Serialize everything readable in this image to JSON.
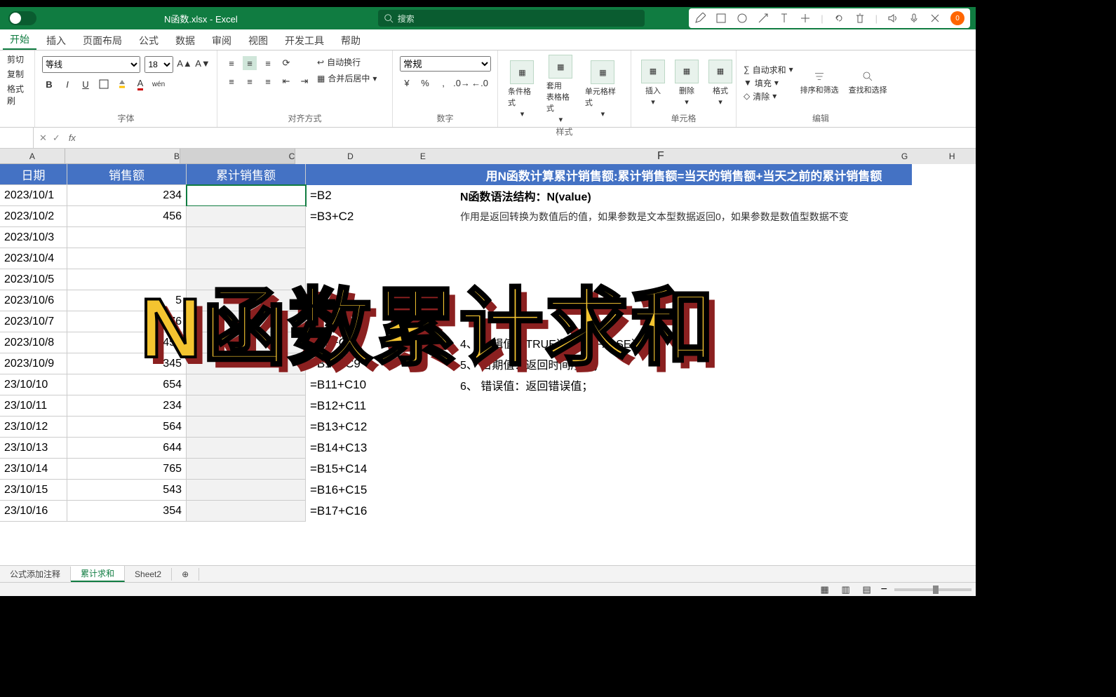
{
  "title": "N函数.xlsx - Excel",
  "search_placeholder": "搜索",
  "tabs": [
    "开始",
    "插入",
    "页面布局",
    "公式",
    "数据",
    "审阅",
    "视图",
    "开发工具",
    "帮助"
  ],
  "active_tab": 0,
  "ribbon": {
    "clipboard": {
      "cut": "剪切",
      "copy": "复制",
      "paint": "格式刷"
    },
    "font": {
      "name": "等线",
      "size": "18",
      "group": "字体"
    },
    "align": {
      "group": "对齐方式",
      "wrap": "自动换行",
      "merge": "合并后居中"
    },
    "number": {
      "group": "数字",
      "format": "常规"
    },
    "styles": {
      "group": "样式",
      "cond": "条件格式",
      "table": "套用\n表格格式",
      "cell": "单元格样式"
    },
    "cells": {
      "group": "单元格",
      "insert": "插入",
      "delete": "删除",
      "format": "格式"
    },
    "editing": {
      "group": "编辑",
      "sum": "自动求和",
      "fill": "填充",
      "clear": "清除",
      "sort": "排序和筛选",
      "find": "查找和选择"
    }
  },
  "namebox": "",
  "formula": "",
  "columns": [
    "A",
    "B",
    "C",
    "D",
    "E",
    "F",
    "G",
    "H"
  ],
  "headers": {
    "A": "日期",
    "B": "销售额",
    "C": "累计销售额"
  },
  "data_rows": [
    {
      "a": "2023/10/1",
      "b": "234",
      "d": "=B2"
    },
    {
      "a": "2023/10/2",
      "b": "456",
      "d": "=B3+C2"
    },
    {
      "a": "2023/10/3",
      "b": "",
      "d": ""
    },
    {
      "a": "2023/10/4",
      "b": "",
      "d": ""
    },
    {
      "a": "2023/10/5",
      "b": "",
      "d": ""
    },
    {
      "a": "2023/10/6",
      "b": "5",
      "d": ""
    },
    {
      "a": "2023/10/7",
      "b": "876",
      "d": ""
    },
    {
      "a": "2023/10/8",
      "b": "453",
      "d": "=B9+C8"
    },
    {
      "a": "2023/10/9",
      "b": "345",
      "d": "=B10+C9"
    },
    {
      "a": "23/10/10",
      "b": "654",
      "d": "=B11+C10"
    },
    {
      "a": "23/10/11",
      "b": "234",
      "d": "=B12+C11"
    },
    {
      "a": "23/10/12",
      "b": "564",
      "d": "=B13+C12"
    },
    {
      "a": "23/10/13",
      "b": "644",
      "d": "=B14+C13"
    },
    {
      "a": "23/10/14",
      "b": "765",
      "d": "=B15+C14"
    },
    {
      "a": "23/10/15",
      "b": "543",
      "d": "=B16+C15"
    },
    {
      "a": "23/10/16",
      "b": "354",
      "d": "=B17+C16"
    }
  ],
  "f_col": {
    "r1": "用N函数计算累计销售额:累计销售额=当天的销售额+当天之前的累计销售额",
    "r2": "N函数语法结构：N(value)",
    "r3": "作用是返回转换为数值后的值，如果参数是文本型数据返回0，如果参数是数值型数据不变",
    "r8": "4、  逻辑值：TRUE返回1，FALSE返回0；",
    "r9": "5、  日期值：返回时间序列；",
    "r10": "6、  错误值：返回错误值；"
  },
  "sheet_tabs": [
    "公式添加注释",
    "累计求和",
    "Sheet2"
  ],
  "active_sheet": 1,
  "overlay": "N函数累计求和"
}
